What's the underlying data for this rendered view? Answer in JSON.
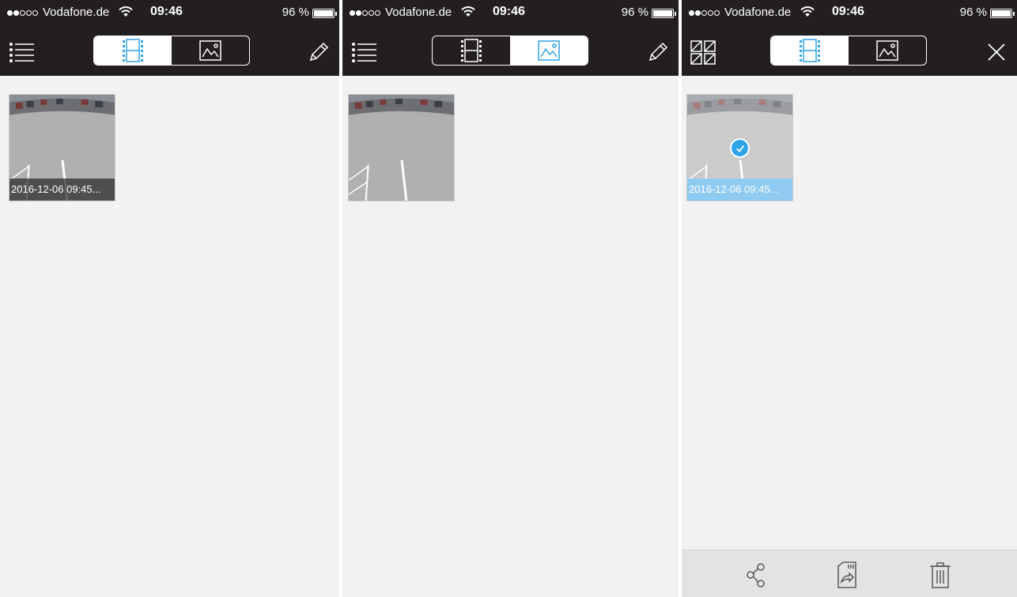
{
  "colors": {
    "bar_background": "#231f20",
    "content_background": "#f2f2f2",
    "accent": "#2ea3e8",
    "selection_caption": "#8fcbf0",
    "toolbar_background": "#e3e3e3"
  },
  "screens": [
    {
      "status": {
        "carrier": "Vodafone.de",
        "time": "09:46",
        "battery": "96 %"
      },
      "nav": {
        "left_icon": "list-icon",
        "tabs": [
          {
            "icon": "film-strip-icon",
            "selected": true
          },
          {
            "icon": "image-icon",
            "selected": false
          }
        ],
        "right_icon": "pencil-icon"
      },
      "items": [
        {
          "caption": "2016-12-06 09:45...",
          "selected": false
        }
      ]
    },
    {
      "status": {
        "carrier": "Vodafone.de",
        "time": "09:46",
        "battery": "96 %"
      },
      "nav": {
        "left_icon": "list-icon",
        "tabs": [
          {
            "icon": "film-strip-icon",
            "selected": false
          },
          {
            "icon": "image-icon",
            "selected": true
          }
        ],
        "right_icon": "pencil-icon"
      },
      "items": [
        {
          "caption": "",
          "selected": false
        }
      ]
    },
    {
      "status": {
        "carrier": "Vodafone.de",
        "time": "09:46",
        "battery": "96 %"
      },
      "nav": {
        "left_icon": "select-all-icon",
        "tabs": [
          {
            "icon": "film-strip-icon",
            "selected": true
          },
          {
            "icon": "image-icon",
            "selected": false
          }
        ],
        "right_icon": "close-icon"
      },
      "items": [
        {
          "caption": "2016-12-06 09:45...",
          "selected": true
        }
      ],
      "toolbar": [
        "share-icon",
        "export-icon",
        "trash-icon"
      ]
    }
  ]
}
